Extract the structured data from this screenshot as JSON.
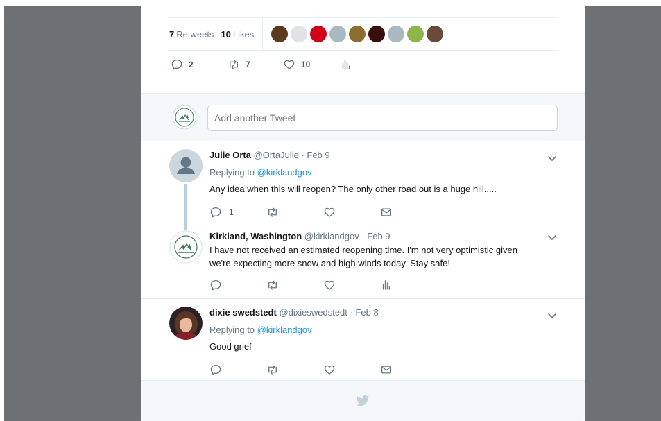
{
  "engagement": {
    "retweets_count": "7",
    "retweets_label": "Retweets",
    "likes_count": "10",
    "likes_label": "Likes",
    "liker_avatar_colors": [
      "#5b3a1e",
      "#dfe3e8",
      "#d0021b",
      "#aab8c2",
      "#8a6d2f",
      "#3a0d0d",
      "#aab8c2",
      "#8fb44a",
      "#6a4a3a"
    ]
  },
  "main_actions": {
    "reply_count": "2",
    "retweet_count": "7",
    "like_count": "10"
  },
  "reply_box": {
    "placeholder": "Add another Tweet"
  },
  "replies": [
    {
      "name": "Julie Orta",
      "handle": "@OrtaJulie",
      "date": "· Feb 9",
      "replying_prefix": "Replying to",
      "replying_handle": "@kirklandgov",
      "text": "Any idea when this will reopen?  The only other road out is a huge hill.....",
      "reply_count": "1"
    },
    {
      "name": "Kirkland, Washington",
      "handle": "@kirklandgov",
      "date": "· Feb 9",
      "text_line1": "I have not received an estimated reopening time. I'm not very optimistic given",
      "text_line2": "we're expecting more snow and high winds today. Stay safe!"
    },
    {
      "name": "dixie swedstedt",
      "handle": "@dixieswedstedt",
      "date": "· Feb 8",
      "replying_prefix": "Replying to",
      "replying_handle": "@kirklandgov",
      "text": "Good grief"
    }
  ],
  "colors": {
    "accent": "#1b95e0",
    "muted": "#657786",
    "thread_line": "#b8cde0",
    "backdrop": "#6e7173"
  }
}
